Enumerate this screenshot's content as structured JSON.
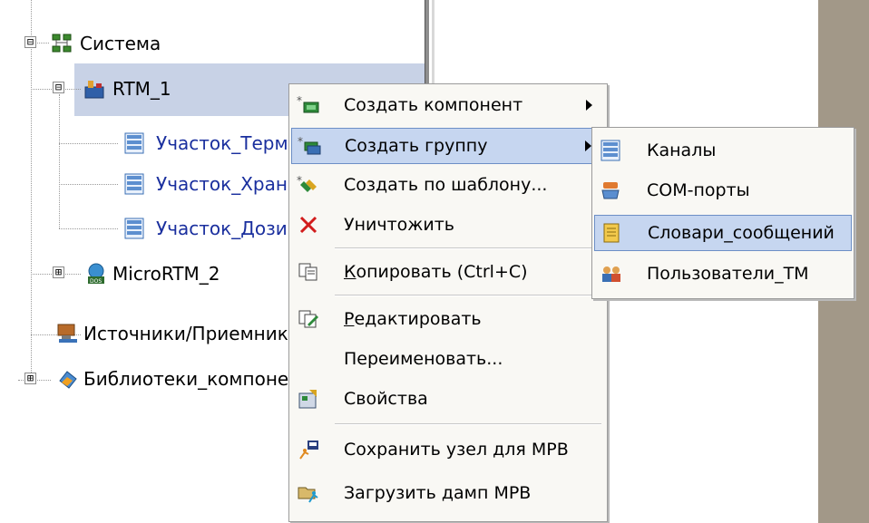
{
  "tree": {
    "root": {
      "label": "Система",
      "expander": "⊟",
      "icon": "network-icon"
    },
    "items": [
      {
        "label": "RTM_1",
        "expander": "⊟",
        "icon": "rtm-icon",
        "selected": true
      },
      {
        "label": "Участок_Терм",
        "icon": "list-icon"
      },
      {
        "label": "Участок_Хран",
        "icon": "list-icon"
      },
      {
        "label": "Участок_Дози",
        "icon": "list-icon"
      },
      {
        "label": "MicroRTM_2",
        "expander": "⊞",
        "icon": "dos-device-icon"
      },
      {
        "label": "Источники/Приемники",
        "icon": "sources-icon"
      },
      {
        "label": "Библиотеки_компонен",
        "expander": "⊞",
        "icon": "library-icon"
      }
    ]
  },
  "context_menu": {
    "items": [
      {
        "label": "Создать компонент",
        "has_submenu": true,
        "icon": "create-component-icon"
      },
      {
        "label": "Создать группу",
        "has_submenu": true,
        "highlighted": true,
        "icon": "create-group-icon"
      },
      {
        "label": "Создать по шаблону...",
        "icon": "create-from-template-icon"
      },
      {
        "label": "Уничтожить",
        "icon": "delete-icon"
      },
      {
        "label": "Копировать (Ctrl+C)",
        "icon": "copy-icon"
      },
      {
        "label": "Редактировать",
        "icon": "edit-icon"
      },
      {
        "label": "Переименовать...",
        "icon": ""
      },
      {
        "label": "Свойства",
        "icon": "properties-icon"
      },
      {
        "label": "Сохранить узел для МРВ",
        "icon": "save-node-icon"
      },
      {
        "label": "Загрузить дамп МРВ",
        "icon": "load-dump-icon"
      }
    ]
  },
  "submenu": {
    "items": [
      {
        "label": "Каналы",
        "icon": "channels-icon"
      },
      {
        "label": "COM-порты",
        "icon": "com-ports-icon"
      },
      {
        "label": "Словари_сообщений",
        "icon": "dictionary-icon",
        "highlighted": true
      },
      {
        "label": "Пользователи_ТМ",
        "icon": "users-icon"
      }
    ]
  },
  "colors": {
    "selection": "#c8d2e6",
    "menu_highlight": "#c6d6f0",
    "menu_highlight_border": "#6d8fc6",
    "menu_bg": "#f9f8f4",
    "right_strip": "#a29888"
  }
}
